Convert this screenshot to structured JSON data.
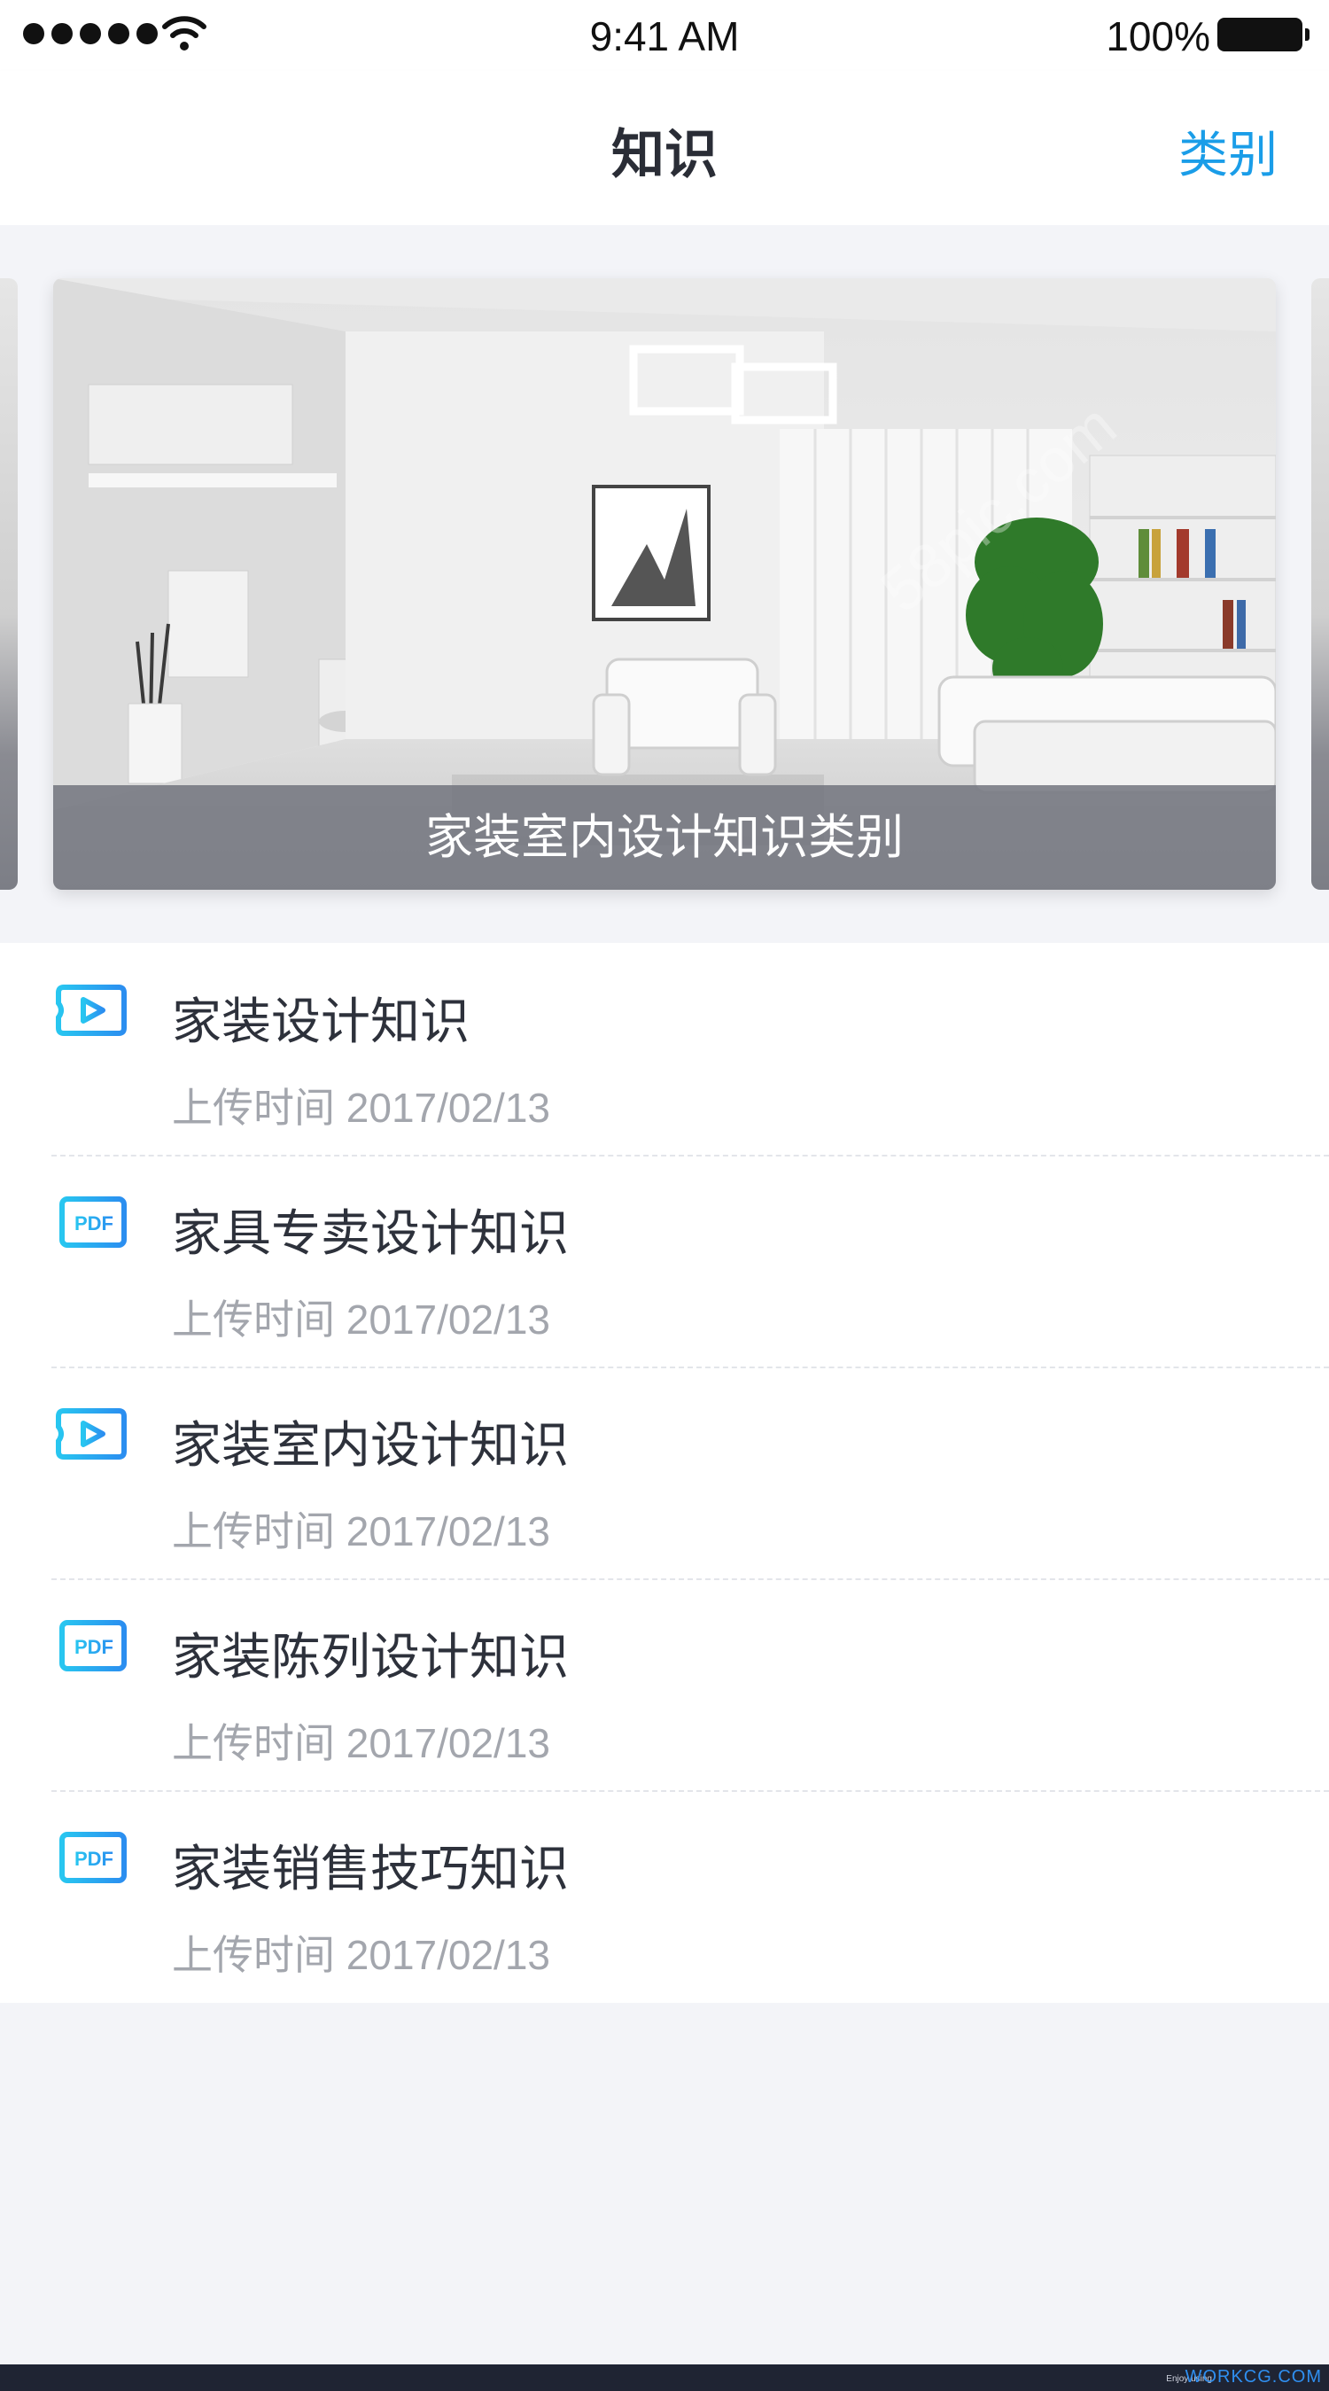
{
  "status_bar": {
    "time": "9:41 AM",
    "battery_percent": "100%",
    "signal_icon": "signal-dots-icon",
    "wifi_icon": "wifi-icon",
    "battery_icon": "battery-icon"
  },
  "nav": {
    "title": "知识",
    "action_label": "类别"
  },
  "banner": {
    "caption": "家装室内设计知识类别",
    "image": "living-room-photo",
    "watermark": "千图网 58pic.com"
  },
  "list": {
    "items": [
      {
        "icon": "video-play-icon",
        "title": "家装设计知识",
        "meta": "上传时间 2017/02/13"
      },
      {
        "icon": "pdf-file-icon",
        "title": "家具专卖设计知识",
        "meta": "上传时间 2017/02/13"
      },
      {
        "icon": "video-play-icon",
        "title": "家装室内设计知识",
        "meta": "上传时间 2017/02/13"
      },
      {
        "icon": "pdf-file-icon",
        "title": "家装陈列设计知识",
        "meta": "上传时间 2017/02/13"
      },
      {
        "icon": "pdf-file-icon",
        "title": "家装销售技巧知识",
        "meta": "上传时间 2017/02/13"
      }
    ]
  },
  "credit": {
    "small": "Enjoy using",
    "brand": "WORKCG.COM"
  },
  "colors": {
    "accent": "#1a9de8",
    "icon_gradient_start": "#28c6f0",
    "icon_gradient_end": "#2b8ef0",
    "title_text": "#2d313b",
    "meta_text": "#a3a6ad",
    "background": "#f3f4f8"
  }
}
